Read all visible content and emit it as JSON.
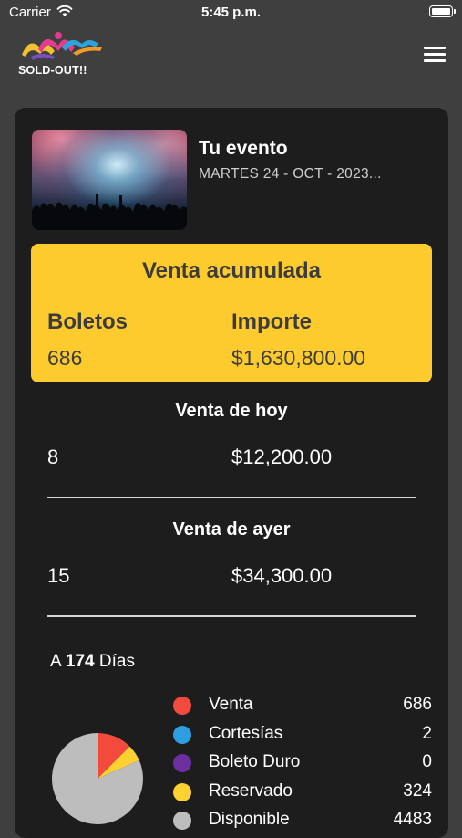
{
  "status_bar": {
    "carrier": "Carrier",
    "time": "5:45 p.m."
  },
  "brand": {
    "name": "SOLD-OUT!!"
  },
  "event": {
    "title": "Tu evento",
    "date": "MARTES 24 - OCT - 2023..."
  },
  "venta_acumulada": {
    "title": "Venta acumulada",
    "boletos_label": "Boletos",
    "importe_label": "Importe",
    "boletos_value": "686",
    "importe_value": "$1,630,800.00",
    "color": "#fecb2e"
  },
  "venta_hoy": {
    "title": "Venta de hoy",
    "boletos": "8",
    "importe": "$12,200.00"
  },
  "venta_ayer": {
    "title": "Venta de ayer",
    "boletos": "15",
    "importe": "$34,300.00"
  },
  "countdown": {
    "prefix": "A",
    "days": "174",
    "suffix": "Días"
  },
  "chart_data": {
    "type": "pie",
    "categories": [
      "Venta",
      "Cortesías",
      "Boleto Duro",
      "Reservado",
      "Disponible"
    ],
    "values": [
      686,
      2,
      0,
      324,
      4483
    ],
    "colors": [
      "#f24a3c",
      "#2d9fe0",
      "#6b2fa0",
      "#fcd131",
      "#bdbdbd"
    ]
  },
  "icons": {
    "menu": "hamburger-menu-icon",
    "wifi": "wifi-icon",
    "battery": "battery-icon"
  }
}
